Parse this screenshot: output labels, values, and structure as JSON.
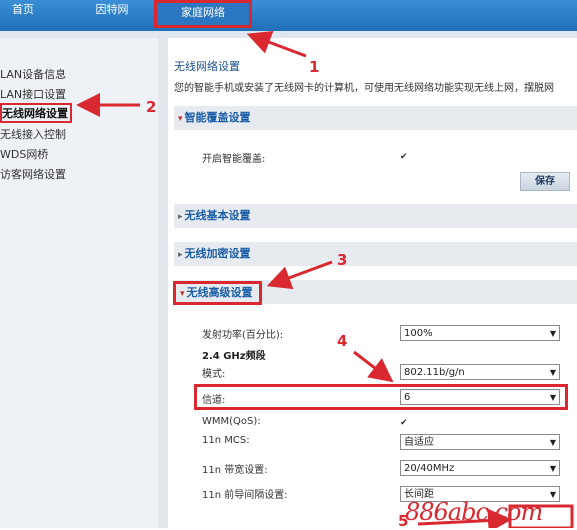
{
  "nav": {
    "tabs": [
      {
        "label": "首页"
      },
      {
        "label": "因特网"
      },
      {
        "label": "家庭网络"
      }
    ]
  },
  "sidebar": {
    "items": [
      {
        "label": "LAN设备信息"
      },
      {
        "label": "LAN接口设置"
      },
      {
        "label": "无线网络设置"
      },
      {
        "label": "无线接入控制"
      },
      {
        "label": "WDS网桥"
      },
      {
        "label": "访客网络设置"
      }
    ]
  },
  "main": {
    "title": "无线网络设置",
    "description": "您的智能手机或安装了无线网卡的计算机，可使用无线网络功能实现无线上网，摆脱网",
    "smart_cover": {
      "header": "智能覆盖设置",
      "toggle_label": "开启智能覆盖:",
      "save_label": "保存"
    },
    "sections": {
      "basic": "无线基本设置",
      "encrypt": "无线加密设置",
      "advanced": "无线高级设置"
    },
    "advanced": {
      "tx_power_label": "发射功率(百分比):",
      "tx_power_value": "100%",
      "band_label": "2.4 GHz频段",
      "mode_label": "模式:",
      "mode_value": "802.11b/g/n",
      "channel_label": "信道:",
      "channel_value": "6",
      "wmm_label": "WMM(QoS):",
      "mcs_label": "11n MCS:",
      "mcs_value": "自适应",
      "bandwidth_label": "11n 带宽设置:",
      "bandwidth_value": "20/40MHz",
      "guard_label": "11n 前导间隔设置:",
      "guard_value": "长间距"
    }
  },
  "annotations": {
    "n1": "1",
    "n2": "2",
    "n3": "3",
    "n4": "4",
    "n5": "5",
    "watermark": "886abc.com"
  },
  "colors": {
    "nav_blue": "#1f6fb9",
    "highlight_red": "#d9282f",
    "section_bg": "#e7eaee",
    "title_blue": "#1a4f8a"
  }
}
